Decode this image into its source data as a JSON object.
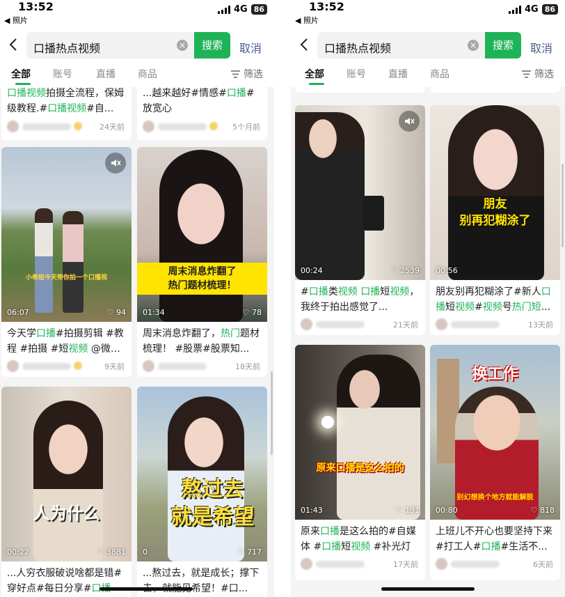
{
  "status": {
    "time": "13:52",
    "back_app": "照片",
    "network": "4G",
    "battery": "86"
  },
  "search": {
    "query": "口播热点视频",
    "search_label": "搜索",
    "cancel_label": "取消"
  },
  "tabs": [
    {
      "label": "全部",
      "active": true
    },
    {
      "label": "账号",
      "active": false
    },
    {
      "label": "直播",
      "active": false
    },
    {
      "label": "商品",
      "active": false
    }
  ],
  "filter_label": "筛选",
  "colors": {
    "accent": "#1fb357",
    "cancel": "#4a5d8a"
  },
  "left": {
    "top_cards": [
      {
        "caption_parts": [
          [
            "口播视频",
            true
          ],
          [
            "拍摄全流程，保姆级教程.#",
            false
          ],
          [
            "口播视频",
            true
          ],
          [
            "#自...",
            false
          ]
        ],
        "time": "24天前"
      },
      {
        "caption_parts": [
          [
            "...越来越好#情感#",
            false
          ],
          [
            "口播",
            true
          ],
          [
            "#放宽心",
            false
          ]
        ],
        "time": "5个月前"
      }
    ],
    "cards": [
      {
        "caption_parts": [
          [
            "今天学",
            false
          ],
          [
            "口播",
            true
          ],
          [
            "#拍摄剪辑 #教程 #拍摄 #短",
            false
          ],
          [
            "视频",
            true
          ],
          [
            " @微信...",
            false
          ]
        ],
        "time": "9天前",
        "duration": "06:07",
        "likes": "94",
        "banner": "小希姐今天带你拍一个口播视",
        "muted": true
      },
      {
        "caption_parts": [
          [
            "周末消息炸翻了，",
            false
          ],
          [
            "热门",
            true
          ],
          [
            "题材梳理！ #股票#股票知...",
            false
          ]
        ],
        "time": "18天前",
        "duration": "01:34",
        "likes": "78",
        "banner": "周末消息炸翻了\n热门题材梳理！",
        "muted": false
      },
      {
        "caption_parts": [
          [
            "...人穷衣服破说啥都是错#穿好点#每日分享#",
            false
          ],
          [
            "口播",
            true
          ]
        ],
        "time": "",
        "duration": "00:22",
        "likes": "3881",
        "banner": "人为什么",
        "muted": false
      },
      {
        "caption_parts": [
          [
            "...熬过去，就是成长；撑下去，就能见希望！#口...",
            false
          ]
        ],
        "time": "",
        "duration": "0",
        "likes": "717",
        "banner": "熬过去\n就是希望",
        "muted": false
      }
    ]
  },
  "right": {
    "cards": [
      {
        "caption_parts": [
          [
            "#",
            false
          ],
          [
            "口播",
            true
          ],
          [
            "类",
            false
          ],
          [
            "视频",
            true
          ],
          [
            " ",
            false
          ],
          [
            "口播",
            true
          ],
          [
            "短",
            false
          ],
          [
            "视频",
            true
          ],
          [
            "，我终于拍出感觉了...",
            false
          ]
        ],
        "time": "21天前",
        "duration": "00:24",
        "likes": "2539",
        "banner": "",
        "muted": true
      },
      {
        "caption_parts": [
          [
            "朋友别再犯糊涂了#新人",
            false
          ],
          [
            "口播",
            true
          ],
          [
            "短",
            false
          ],
          [
            "视频",
            true
          ],
          [
            "#",
            false
          ],
          [
            "视频",
            true
          ],
          [
            "号",
            false
          ],
          [
            "热门短",
            true
          ],
          [
            "...",
            false
          ]
        ],
        "time": "13天前",
        "duration": "00:56",
        "likes": "",
        "banner": "朋友\n别再犯糊涂了",
        "muted": false
      },
      {
        "caption_parts": [
          [
            "原来",
            false
          ],
          [
            "口播",
            true
          ],
          [
            "是这么拍的#自媒体 #",
            false
          ],
          [
            "口播",
            true
          ],
          [
            "短",
            false
          ],
          [
            "视频",
            true
          ],
          [
            " #补光灯",
            false
          ]
        ],
        "time": "17天前",
        "duration": "01:43",
        "likes": "131",
        "banner": "原来口播是这么拍的",
        "muted": false
      },
      {
        "caption_parts": [
          [
            "上班儿不开心也要坚持下来#打工人#",
            false
          ],
          [
            "口播",
            true
          ],
          [
            "#生活不...",
            false
          ]
        ],
        "time": "6天前",
        "duration": "00:80",
        "likes": "818",
        "banner": "换工作",
        "banner2": "别幻想换个地方就能解脱",
        "muted": false
      }
    ]
  }
}
